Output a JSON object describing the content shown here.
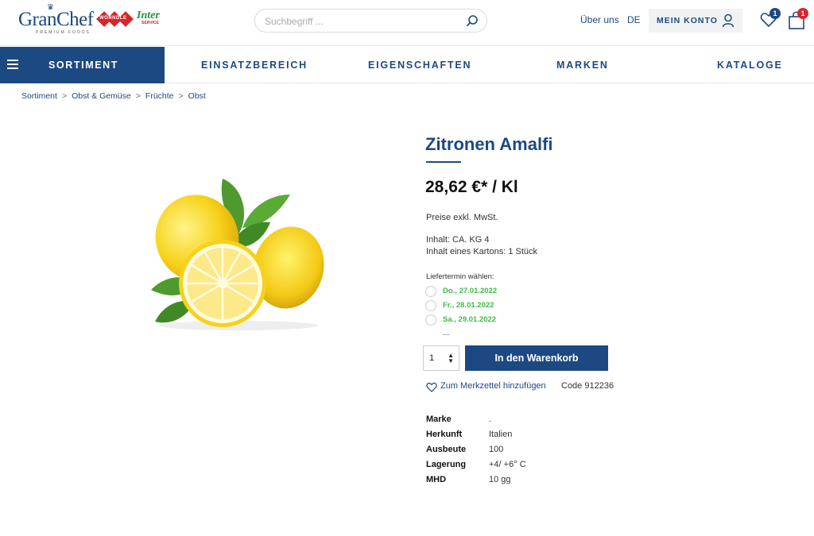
{
  "header": {
    "logo": {
      "brand": "GranChef",
      "tagline": "PREMIUM FOODS",
      "partner1": "WÖRNDLE",
      "partner2_top": "Inter",
      "partner2_bottom": "SERVICE"
    },
    "search": {
      "placeholder": "Suchbegriff ..."
    },
    "about_label": "Über uns",
    "language": "DE",
    "account_label": "MEIN KONTO",
    "wishlist_count": "1",
    "cart_count": "1",
    "colors": {
      "primary": "#1d4983",
      "badge_red": "#d6262b",
      "delivery_green": "#3dbb48"
    }
  },
  "nav": {
    "sortiment": "SORTIMENT",
    "items": [
      "EINSATZBEREICH",
      "EIGENSCHAFTEN",
      "MARKEN",
      "KATALOGE"
    ]
  },
  "breadcrumb": [
    "Sortiment",
    "Obst & Gemüse",
    "Früchte",
    "Obst"
  ],
  "product": {
    "title": "Zitronen Amalfi",
    "price": "28,62 €* / Kl",
    "tax_note": "Preise exkl. MwSt.",
    "content": "Inhalt: CA. KG 4",
    "content_carton": "Inhalt eines Kartons: 1 Stück",
    "delivery_label": "Liefertermin wählen:",
    "delivery_dates": [
      "Do., 27.01.2022",
      "Fr., 28.01.2022",
      "Sa., 29.01.2022"
    ],
    "delivery_more": "...",
    "quantity": "1",
    "add_to_cart": "In den Warenkorb",
    "wishlist_link": "Zum Merkzettel hinzufügen",
    "code": "Code 912236",
    "specs": [
      {
        "key": "Marke",
        "value": "."
      },
      {
        "key": "Herkunft",
        "value": "Italien"
      },
      {
        "key": "Ausbeute",
        "value": "100"
      },
      {
        "key": "Lagerung",
        "value": "+4/ +6° C"
      },
      {
        "key": "MHD",
        "value": "10 gg"
      }
    ]
  }
}
